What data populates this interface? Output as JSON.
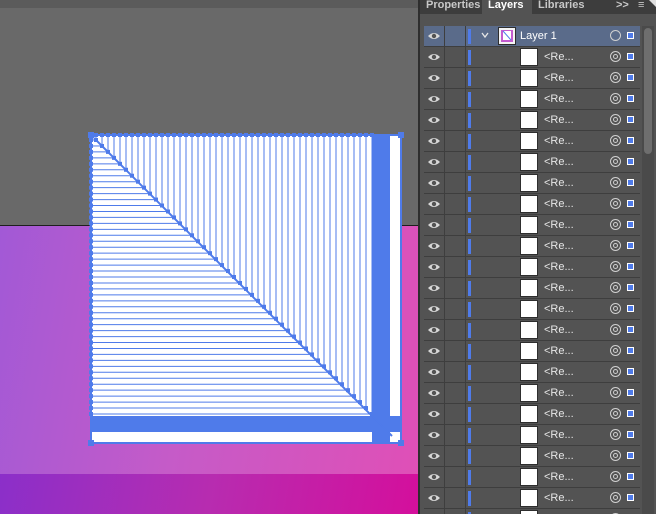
{
  "panel": {
    "tabs": [
      "Properties",
      "Layers",
      "Libraries"
    ],
    "active_tab": "Layers",
    "overflow_glyph": ">>",
    "menu_glyph": "≡"
  },
  "layers": {
    "parent": {
      "name": "Layer 1",
      "expanded": true,
      "color": "#4f7bea"
    },
    "child_label": "<Re...",
    "child_count": 23
  },
  "icons": {
    "visibility": "eye-icon",
    "expand": "chevron-down-icon",
    "target": "target-circle-icon",
    "selected": "selection-square-icon"
  },
  "colors": {
    "selection": "#4f7bea",
    "canvas": "#696969",
    "artboard_gradient_start": "#a259d6",
    "artboard_gradient_end": "#e04fb6"
  }
}
